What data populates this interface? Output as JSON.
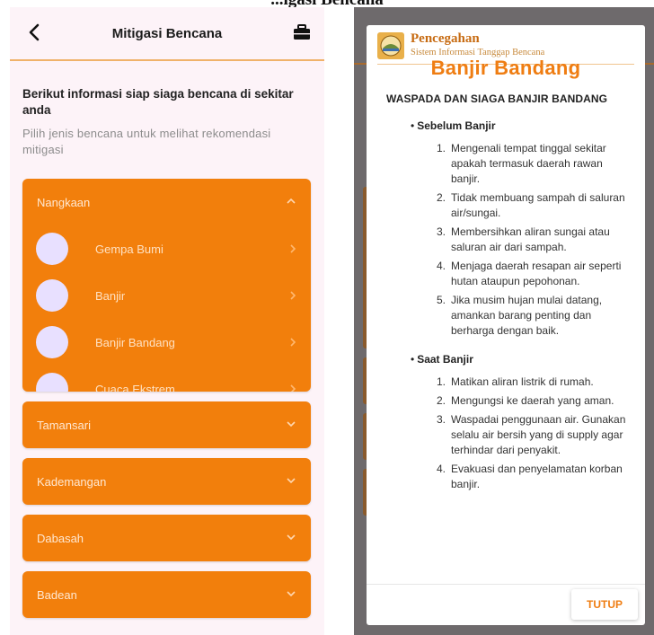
{
  "caption": "...igasi Bencana",
  "left": {
    "appbar": {
      "title": "Mitigasi Bencana",
      "back_icon": "arrow-left-icon",
      "action_icon": "briefcase-icon"
    },
    "intro": {
      "heading": "Berikut informasi siap siaga bencana di sekitar anda",
      "subtitle": "Pilih jenis bencana untuk melihat rekomendasi mitigasi"
    },
    "accordions": [
      {
        "label": "Nangkaan",
        "open": true,
        "items": [
          "Gempa Bumi",
          "Banjir",
          "Banjir Bandang",
          "Cuaca Ekstrem"
        ]
      },
      {
        "label": "Tamansari",
        "open": false
      },
      {
        "label": "Kademangan",
        "open": false
      },
      {
        "label": "Dabasah",
        "open": false
      },
      {
        "label": "Badean",
        "open": false
      }
    ],
    "colors": {
      "accent": "#f27f0c",
      "background": "#fdf3f8",
      "avatar": "#e8e0ff"
    }
  },
  "right": {
    "dialog": {
      "app_title": "Pencegahan",
      "app_subtitle": "Sistem Informasi Tanggap Bencana",
      "heading": "Banjir Bandang",
      "section_title": "WASPADA DAN SIAGA BANJIR BANDANG",
      "phases": [
        {
          "bullet": "•",
          "title": "Sebelum Banjir",
          "steps": [
            "Mengenali tempat tinggal sekitar apakah termasuk daerah rawan banjir.",
            "Tidak membuang sampah di saluran air/sungai.",
            "Membersihkan aliran sungai atau saluran air dari sampah.",
            "Menjaga daerah resapan air seperti hutan ataupun pepohonan.",
            "Jika musim hujan mulai datang, amankan barang penting dan berharga dengan baik."
          ]
        },
        {
          "bullet": "•",
          "title": "Saat Banjir",
          "steps": [
            "Matikan aliran listrik di rumah.",
            "Mengungsi ke daerah yang aman.",
            "Waspadai penggunaan air. Gunakan selalu air bersih yang di supply agar terhindar dari penyakit.",
            "Evakuasi dan penyelamatan korban banjir."
          ]
        }
      ],
      "close_label": "TUTUP",
      "colors": {
        "accent": "#ef7d12",
        "scrim": "#6e6a6c"
      }
    }
  }
}
